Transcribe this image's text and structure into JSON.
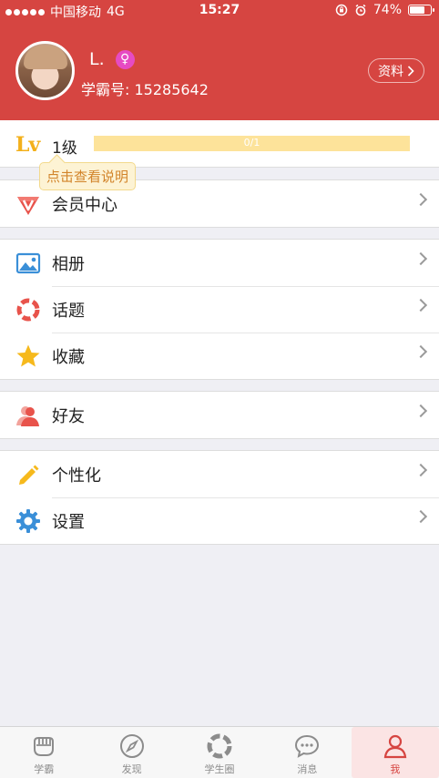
{
  "status_bar": {
    "carrier": "中国移动",
    "network": "4G",
    "time": "15:27",
    "battery": "74%"
  },
  "profile": {
    "name": "L.",
    "gender_symbol": "♀",
    "id_label": "学霸号: 15285642",
    "edit_label": "资料"
  },
  "level": {
    "icon_text": "Lv",
    "label": "1级",
    "progress_text": "0/1",
    "progress_fraction": 0,
    "tooltip": "点击查看说明"
  },
  "menu": {
    "vip": "会员中心",
    "album": "相册",
    "topics": "话题",
    "favorites": "收藏",
    "friends": "好友",
    "personalize": "个性化",
    "settings": "设置"
  },
  "tabs": [
    {
      "label": "学霸",
      "icon": "fist-icon"
    },
    {
      "label": "发现",
      "icon": "compass-icon"
    },
    {
      "label": "学生圈",
      "icon": "shutter-icon"
    },
    {
      "label": "消息",
      "icon": "chat-bubble-icon"
    },
    {
      "label": "我",
      "icon": "user-icon"
    }
  ],
  "colors": {
    "brand": "#d64541",
    "level_gold": "#f3b01b",
    "tooltip_text": "#d2842a",
    "active_tab_bg": "#fbe4e4"
  }
}
